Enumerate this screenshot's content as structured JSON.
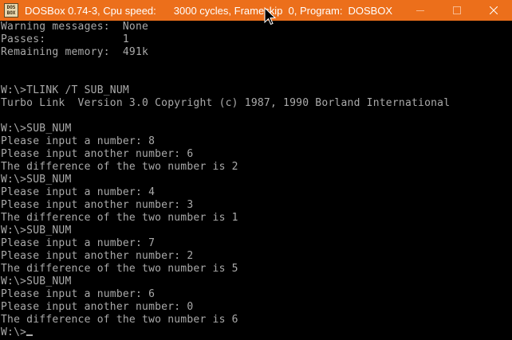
{
  "window": {
    "icon_text": "DOS BOX",
    "title_app": "DOSBox 0.74-3, Cpu speed:",
    "title_cycles": "3000 cycles, Frameskip  0, Program:",
    "title_program": "DOSBOX",
    "colors": {
      "titlebar": "#ec6f1b",
      "title_text": "#ffffff",
      "console_bg": "#000000",
      "console_text": "#aaaaaa"
    }
  },
  "controls": {
    "minimize_icon": "minimize-icon",
    "maximize_icon": "maximize-icon",
    "close_icon": "close-icon"
  },
  "console": {
    "lines": [
      "Warning messages:  None",
      "Passes:            1",
      "Remaining memory:  491k",
      "",
      "",
      "W:\\>TLINK /T SUB_NUM",
      "Turbo Link  Version 3.0 Copyright (c) 1987, 1990 Borland International",
      "",
      "W:\\>SUB_NUM",
      "Please input a number: 8",
      "Please input another number: 6",
      "The difference of the two number is 2",
      "W:\\>SUB_NUM",
      "Please input a number: 4",
      "Please input another number: 3",
      "The difference of the two number is 1",
      "W:\\>SUB_NUM",
      "Please input a number: 7",
      "Please input another number: 2",
      "The difference of the two number is 5",
      "W:\\>SUB_NUM",
      "Please input a number: 6",
      "Please input another number: 0",
      "The difference of the two number is 6"
    ],
    "prompt": "W:\\>"
  }
}
